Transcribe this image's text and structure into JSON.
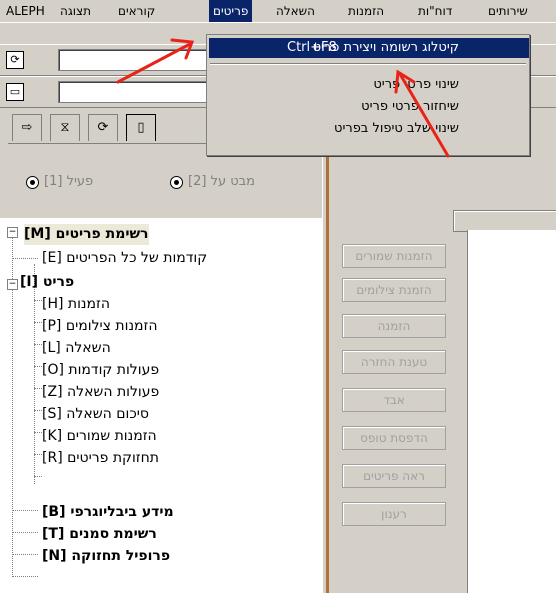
{
  "menubar": {
    "items": [
      "ALEPH",
      "תצוגה",
      "קוראים",
      "פריטים",
      "השאלה",
      "הזמנות",
      "דוח\"ות",
      "שירותים"
    ],
    "active": "פריטים"
  },
  "dropdown": {
    "items": [
      {
        "label": "קיטלוג רשומה ויצירת פריט",
        "shortcut": "Ctrl+F8",
        "selected": true
      },
      {
        "label": "שינוי פרטי פריט"
      },
      {
        "label": "שיחזור פרטי פריט"
      },
      {
        "label": "שינוי שלב טיפול בפריט"
      }
    ]
  },
  "radios": [
    {
      "label": "פעיל [1]",
      "checked": true
    },
    {
      "label": "מבט על [2]",
      "checked": true
    }
  ],
  "tree": {
    "items": [
      {
        "label": "רשימת פריטים [M]",
        "bold": true
      },
      {
        "label": "קודמות של כל הפריטים [E]"
      },
      {
        "label": "פריט [I]",
        "bold": true
      },
      {
        "label": "הזמנות [H]"
      },
      {
        "label": "הזמנות צילומים [P]"
      },
      {
        "label": "השאלה [L]"
      },
      {
        "label": "פעולות קודמות [O]"
      },
      {
        "label": "פעולות השאלה [Z]"
      },
      {
        "label": "סיכום השאלה [S]"
      },
      {
        "label": "הזמנות שמורים [K]"
      },
      {
        "label": "תחזוקת פריטים [R]"
      },
      {
        "label": "מידע ביבליוגרפי [B]",
        "bold": true
      },
      {
        "label": "רשימת סמנים [T]",
        "bold": true
      },
      {
        "label": "פרופיל תחזוקה [N]",
        "bold": true
      }
    ]
  },
  "side_buttons": [
    "הזמנות שמורים",
    "הזמנת צילומים",
    "הזמנה",
    "טענת החזרה",
    "אבד",
    "הדפסת טופס",
    "ראה פריטים",
    "רענון"
  ],
  "colors": {
    "highlight": "#0a246a",
    "arrow": "#e8231a",
    "splitter": "#b0703a"
  }
}
